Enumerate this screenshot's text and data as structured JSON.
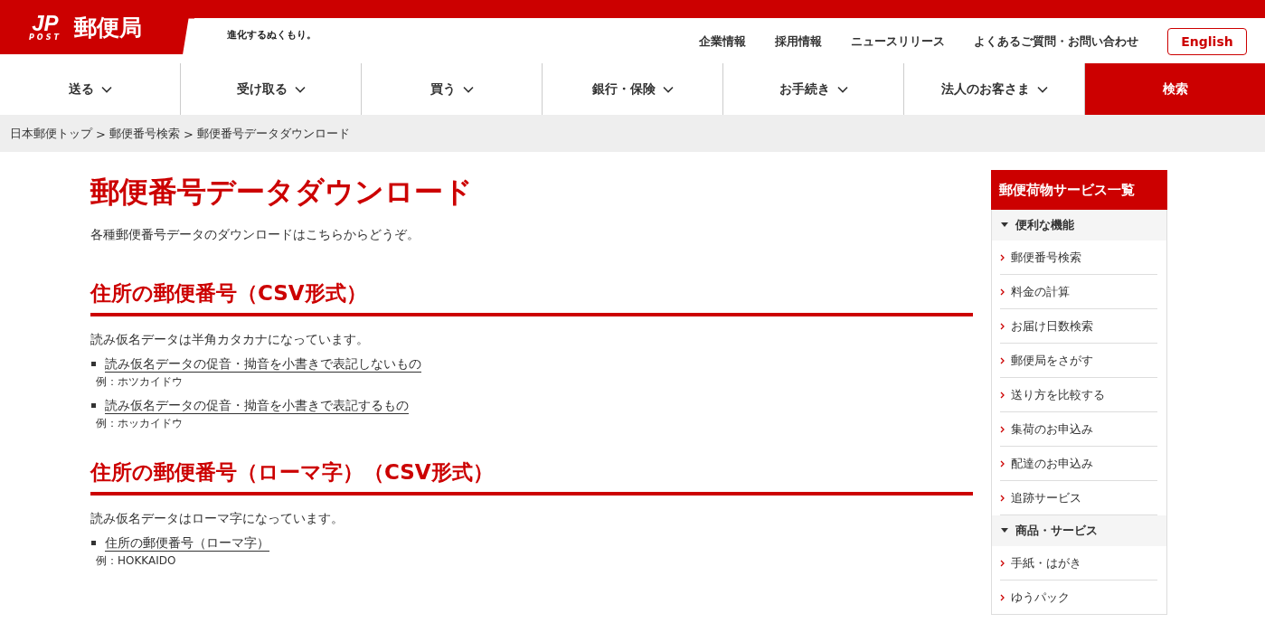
{
  "header": {
    "logo_mark": "JP",
    "logo_sub": "POST",
    "logo_name": "郵便局",
    "tagline": "進化するぬくもり。",
    "utility_links": [
      "企業情報",
      "採用情報",
      "ニュースリリース",
      "よくあるご質問・お問い合わせ"
    ],
    "language_button": "English"
  },
  "nav": {
    "items": [
      {
        "label": "送る"
      },
      {
        "label": "受け取る"
      },
      {
        "label": "買う"
      },
      {
        "label": "銀行・保険"
      },
      {
        "label": "お手続き"
      },
      {
        "label": "法人のお客さま"
      }
    ],
    "search_button": "検索"
  },
  "breadcrumb": {
    "items": [
      "日本郵便トップ",
      "郵便番号検索",
      "郵便番号データダウンロード"
    ],
    "separator": ">"
  },
  "main": {
    "title": "郵便番号データダウンロード",
    "intro": "各種郵便番号データのダウンロードはこちらからどうぞ。",
    "sections": [
      {
        "heading": "住所の郵便番号（CSV形式）",
        "note": "読み仮名データは半角カタカナになっています。",
        "links": [
          {
            "label": "読み仮名データの促音・拗音を小書きで表記しないもの",
            "example": "例：ホツカイドウ"
          },
          {
            "label": "読み仮名データの促音・拗音を小書きで表記するもの",
            "example": "例：ホッカイドウ"
          }
        ]
      },
      {
        "heading": "住所の郵便番号（ローマ字）（CSV形式）",
        "note": "読み仮名データはローマ字になっています。",
        "links": [
          {
            "label": "住所の郵便番号（ローマ字）",
            "example": "例：HOKKAIDO"
          }
        ]
      }
    ]
  },
  "sidebar": {
    "title": "郵便荷物サービス一覧",
    "groups": [
      {
        "heading": "便利な機能",
        "expanded": true,
        "items": [
          "郵便番号検索",
          "料金の計算",
          "お届け日数検索",
          "郵便局をさがす",
          "送り方を比較する",
          "集荷のお申込み",
          "配達のお申込み",
          "追跡サービス"
        ]
      },
      {
        "heading": "商品・サービス",
        "expanded": true,
        "items": [
          "手紙・はがき",
          "ゆうパック"
        ]
      }
    ]
  }
}
